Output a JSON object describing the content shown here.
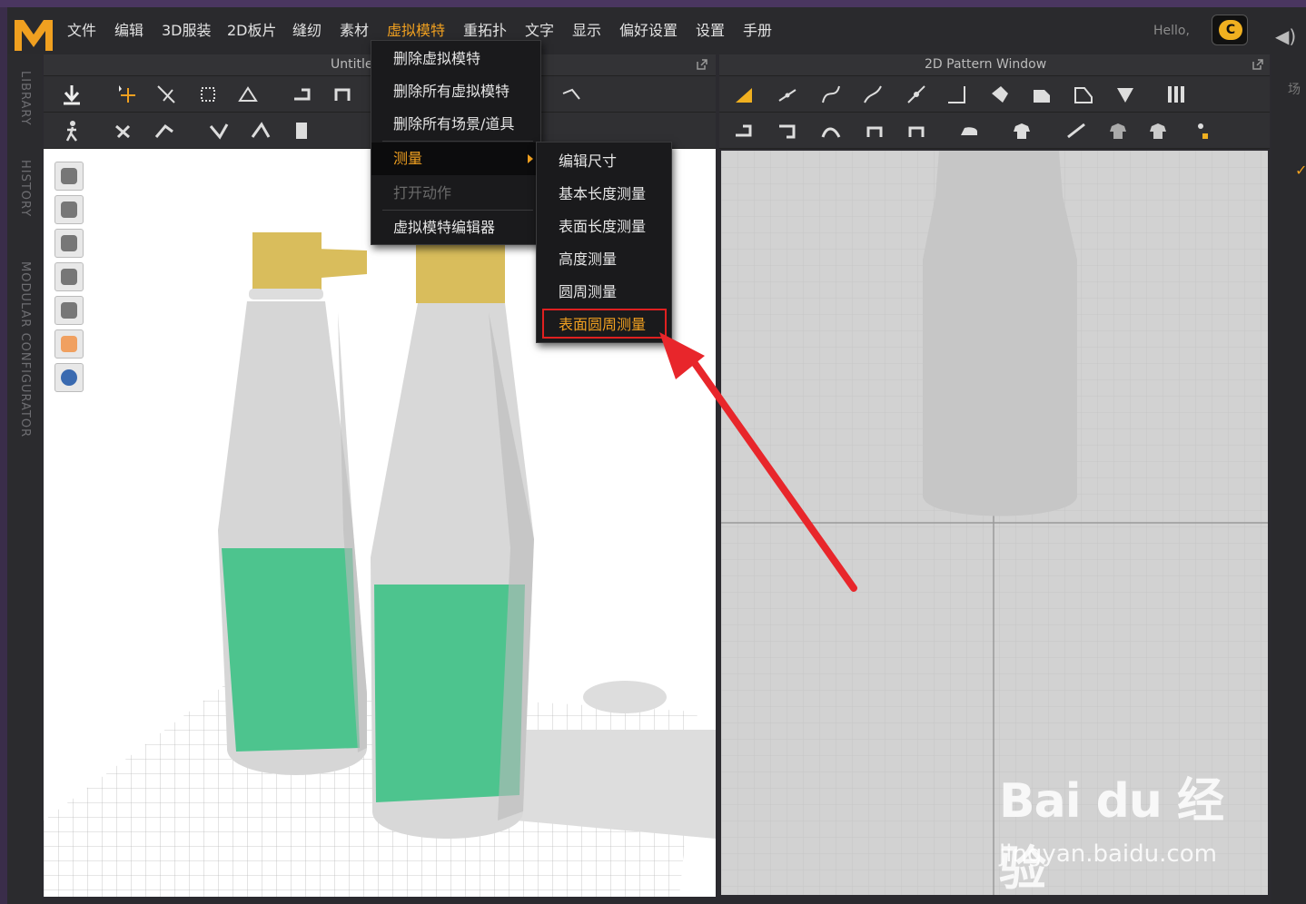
{
  "menubar": {
    "items": [
      "文件",
      "编辑",
      "3D服装",
      "2D板片",
      "缝纫",
      "素材",
      "虚拟模特",
      "重拓扑",
      "文字",
      "显示",
      "偏好设置",
      "设置",
      "手册"
    ],
    "active_index": 6,
    "hello": "Hello,",
    "cloud_label": "C"
  },
  "vtabs": [
    "LIBRARY",
    "HISTORY",
    "MODULAR CONFIGURATOR"
  ],
  "window3d": {
    "title": "Untitled"
  },
  "window2d": {
    "title": "2D Pattern Window"
  },
  "rightpanel": {
    "label": "场"
  },
  "dropdown": {
    "items": [
      "删除虚拟模特",
      "删除所有虚拟模特",
      "删除所有场景/道具",
      "测量",
      "打开动作",
      "虚拟模特编辑器"
    ],
    "highlight_index": 3,
    "disabled_index": 4
  },
  "submenu": {
    "items": [
      "编辑尺寸",
      "基本长度测量",
      "表面长度测量",
      "高度测量",
      "圆周测量",
      "表面圆周测量"
    ],
    "target_index": 5
  },
  "watermark": {
    "logo": "Bai du 经验",
    "url": "jingyan.baidu.com"
  },
  "colors": {
    "accent": "#f0a020",
    "highlight_red": "#e02020",
    "bottle_label": "#4dc48e",
    "cap": "#d9bd5c"
  }
}
